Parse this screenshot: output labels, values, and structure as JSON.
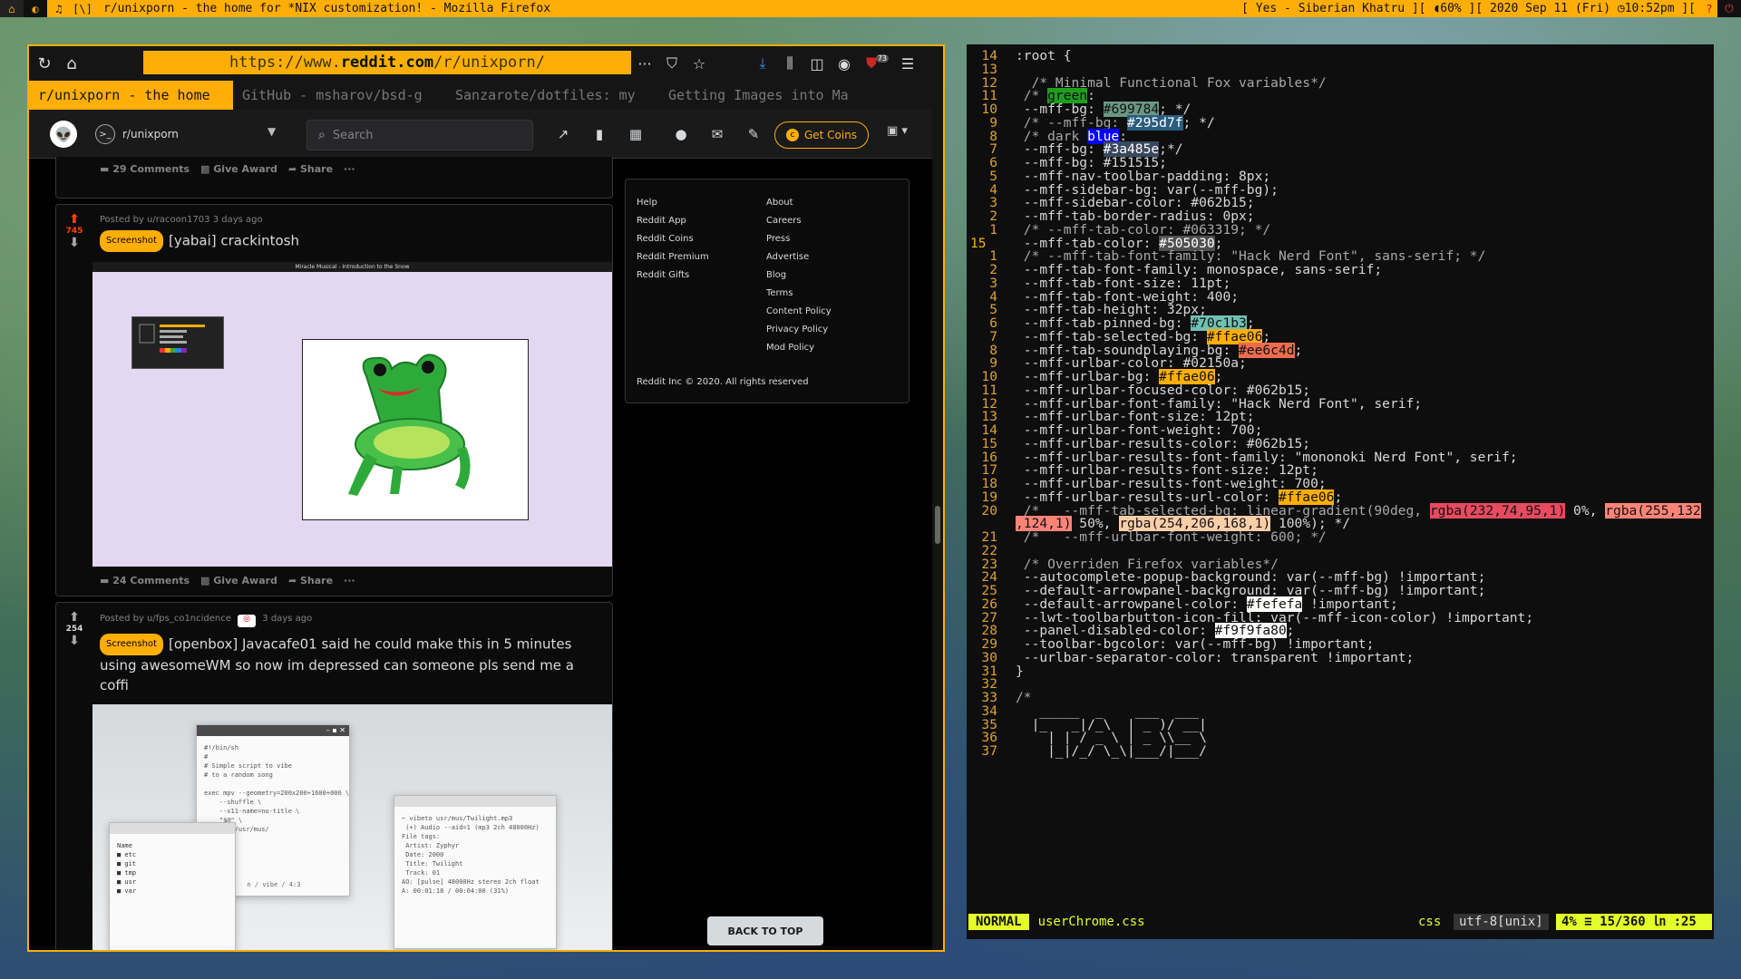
{
  "topbar": {
    "workspaces": [
      "⌂",
      "◐",
      "♫",
      "[\\]"
    ],
    "title": "r/unixporn - the home for *NIX customization! - Mozilla Firefox",
    "status": "[ Yes - Siberian Khatru ][ ◖60% ][ 2020 Sep 11 (Fri) ◷10:52pm ][",
    "help_icon": "?",
    "power_icon": "⏻"
  },
  "firefox": {
    "url_prefix": "https://www.",
    "url_domain": "reddit.com",
    "url_path": "/r/unixporn/",
    "badge_count": "73",
    "tabs": [
      "r/unixporn - the home",
      "GitHub - msharov/bsd-g",
      "Sanzarote/dotfiles: my",
      "Getting Images into Ma"
    ]
  },
  "reddit": {
    "subreddit": "r/unixporn",
    "search_placeholder": "Search",
    "get_coins": "Get Coins",
    "post0": {
      "comments": "29 Comments",
      "award": "Give Award",
      "share": "Share",
      "more": "···"
    },
    "post1": {
      "meta": "Posted by u/racoon1703 3 days ago",
      "votes": "745",
      "flair": "Screenshot",
      "title": "[yabai] crackintosh",
      "img_bar": "Miracle Musical - Introduction to the Snow",
      "comments": "24 Comments",
      "award": "Give Award",
      "share": "Share",
      "more": "···"
    },
    "post2": {
      "meta_user": "Posted by u/fps_co1ncidence",
      "meta_time": "3 days ago",
      "votes": "254",
      "flair": "Screenshot",
      "title": "[openbox] Javacafe01 said he could make this in 5 minutes using awesomeWM so now im depressed can someone pls send me a coffi",
      "script": "#!/bin/sh\n#\n# Simple script to vibe\n# to a random song\n\nexec mpv --geometry=200x200+1600+000 \\\n    --shuffle \\\n    --x11-name=no-title \\\n    \"$@\" \\\n    -- ~/usr/mus/",
      "script_footer": "n / vibe / 4:3",
      "player": "~ vibeto usr/mus/Twilight.mp3\n (+) Audio --aid=1 (mp3 2ch 48000Hz)\nFile tags:\n Artist: Zyphyr\n Date: 2000\n Title: Twilight\n Track: 01\nAO: [pulse] 48000Hz stereo 2ch float\nA: 00:01:18 / 00:04:00 (31%)",
      "files": "Name\n■ etc\n■ git\n■ tmp\n■ usr\n■ var"
    },
    "sidebar_left": [
      "Help",
      "Reddit App",
      "Reddit Coins",
      "Reddit Premium",
      "Reddit Gifts"
    ],
    "sidebar_right": [
      "About",
      "Careers",
      "Press",
      "Advertise",
      "Blog",
      "Terms",
      "Content Policy",
      "Privacy Policy",
      "Mod Policy"
    ],
    "copyright": "Reddit Inc © 2020. All rights reserved",
    "back_to_top": "BACK TO TOP"
  },
  "vim": {
    "lines": [
      {
        "n": "14",
        "t": ":root {"
      },
      {
        "n": "13",
        "t": ""
      },
      {
        "n": "12",
        "t": "  /* Minimal Functional Fox variables*/"
      },
      {
        "n": "11",
        "t": " /* ",
        "hl": "green",
        "hlc": "#1f9e1f",
        "post": ":"
      },
      {
        "n": "10",
        "t": " --mff-bg: ",
        "hl": "#699784",
        "hlc": "#699784",
        "post": "; */"
      },
      {
        "n": "9",
        "t": " /* --mff-bg: ",
        "hl": "#295d7f",
        "hlc": "#295d7f",
        "post": "; */",
        "hlw": true
      },
      {
        "n": "8",
        "t": " /* dark ",
        "hl": "blue",
        "hlc": "#0000ff",
        "post": ":",
        "hlw": true
      },
      {
        "n": "7",
        "t": " --mff-bg: ",
        "hl": "#3a485e",
        "hlc": "#3a485e",
        "post": ";*/",
        "hlw": true
      },
      {
        "n": "6",
        "t": " --mff-bg: #151515;"
      },
      {
        "n": "5",
        "t": " --mff-nav-toolbar-padding: 8px;"
      },
      {
        "n": "4",
        "t": " --mff-sidebar-bg: var(--mff-bg);"
      },
      {
        "n": "3",
        "t": " --mff-sidebar-color: #062b15;"
      },
      {
        "n": "2",
        "t": " --mff-tab-border-radius: 0px;"
      },
      {
        "n": "1",
        "t": " /* --mff-tab-color: #063319; */"
      },
      {
        "n": "15",
        "t": " --mff-tab-color: ",
        "hl": "#505030",
        "hlc": "#505050",
        "post": ";",
        "hlw": true,
        "cur": true
      },
      {
        "n": "1",
        "t": " /* --mff-tab-font-family: \"Hack Nerd Font\", sans-serif; */"
      },
      {
        "n": "2",
        "t": " --mff-tab-font-family: monospace, sans-serif;"
      },
      {
        "n": "3",
        "t": " --mff-tab-font-size: 11pt;"
      },
      {
        "n": "4",
        "t": " --mff-tab-font-weight: 400;"
      },
      {
        "n": "5",
        "t": " --mff-tab-height: 32px;"
      },
      {
        "n": "6",
        "t": " --mff-tab-pinned-bg: ",
        "hl": "#70c1b3",
        "hlc": "#70c1b3",
        "post": ";"
      },
      {
        "n": "7",
        "t": " --mff-tab-selected-bg: ",
        "hl": "#ffae06",
        "hlc": "#ffae06",
        "post": ";"
      },
      {
        "n": "8",
        "t": " --mff-tab-soundplaying-bg: ",
        "hl": "#ee6c4d",
        "hlc": "#ee6c4d",
        "post": ";"
      },
      {
        "n": "9",
        "t": " --mff-urlbar-color: #02150a;"
      },
      {
        "n": "10",
        "t": " --mff-urlbar-bg: ",
        "hl": "#ffae06",
        "hlc": "#ffae06",
        "post": ";"
      },
      {
        "n": "11",
        "t": " --mff-urlbar-focused-color: #062b15;"
      },
      {
        "n": "12",
        "t": " --mff-urlbar-font-family: \"Hack Nerd Font\", serif;"
      },
      {
        "n": "13",
        "t": " --mff-urlbar-font-size: 12pt;"
      },
      {
        "n": "14",
        "t": " --mff-urlbar-font-weight: 700;"
      },
      {
        "n": "15",
        "t": " --mff-urlbar-results-color: #062b15;"
      },
      {
        "n": "16",
        "t": " --mff-urlbar-results-font-family: \"mononoki Nerd Font\", serif;"
      },
      {
        "n": "17",
        "t": " --mff-urlbar-results-font-size: 12pt;"
      },
      {
        "n": "18",
        "t": " --mff-urlbar-results-font-weight: 700;"
      },
      {
        "n": "19",
        "t": " --mff-urlbar-results-url-color: ",
        "hl": "#ffae06",
        "hlc": "#ffae06",
        "post": ";"
      },
      {
        "n": "20",
        "t": " /*   --mff-tab-selected-bg: linear-gradient(90deg, ",
        "hl": "rgba(232,74,95,1)",
        "hlc": "#e84a5f",
        "post": " 0%, ",
        "hl2": "rgba(255,132",
        "hlc2": "#ff8478"
      },
      {
        "n": "",
        "t": "",
        "hl": ",124,1)",
        "hlc": "#ff8478",
        "post": " 50%, ",
        "hl2": "rgba(254,206,168,1)",
        "hlc2": "#fecea8",
        "post2": " 100%); */"
      },
      {
        "n": "21",
        "t": " /*   --mff-urlbar-font-weight: 600; */"
      },
      {
        "n": "22",
        "t": ""
      },
      {
        "n": "23",
        "t": " /* Overriden Firefox variables*/"
      },
      {
        "n": "24",
        "t": " --autocomplete-popup-background: var(--mff-bg) !important;"
      },
      {
        "n": "25",
        "t": " --default-arrowpanel-background: var(--mff-bg) !important;"
      },
      {
        "n": "26",
        "t": " --default-arrowpanel-color: ",
        "hl": "#fefefa",
        "hlc": "#fefefa",
        "post": " !important;"
      },
      {
        "n": "27",
        "t": " --lwt-toolbarbutton-icon-fill: var(--mff-icon-color) !important;"
      },
      {
        "n": "28",
        "t": " --panel-disabled-color: ",
        "hl": "#f9f9fa80",
        "hlc": "#f9f9fa",
        "post": ";"
      },
      {
        "n": "29",
        "t": " --toolbar-bgcolor: var(--mff-bg) !important;"
      },
      {
        "n": "30",
        "t": " --urlbar-separator-color: transparent !important;"
      },
      {
        "n": "31",
        "t": "}"
      },
      {
        "n": "32",
        "t": ""
      },
      {
        "n": "33",
        "t": "/*"
      },
      {
        "n": "34",
        "t": "   _____  _    ___  ___"
      },
      {
        "n": "35",
        "t": "  |_   _|/_\\  | _ )/ __|"
      },
      {
        "n": "36",
        "t": "    | | / _ \\ | _ \\\\__ \\"
      },
      {
        "n": "37",
        "t": "    |_|/_/ \\_\\|___/|___/"
      }
    ],
    "status": {
      "mode": "NORMAL",
      "file": "userChrome.css",
      "ft": "css",
      "enc": "utf-8[unix]",
      "pos": "4% ≡ 15/360 ㏑ :25"
    }
  }
}
